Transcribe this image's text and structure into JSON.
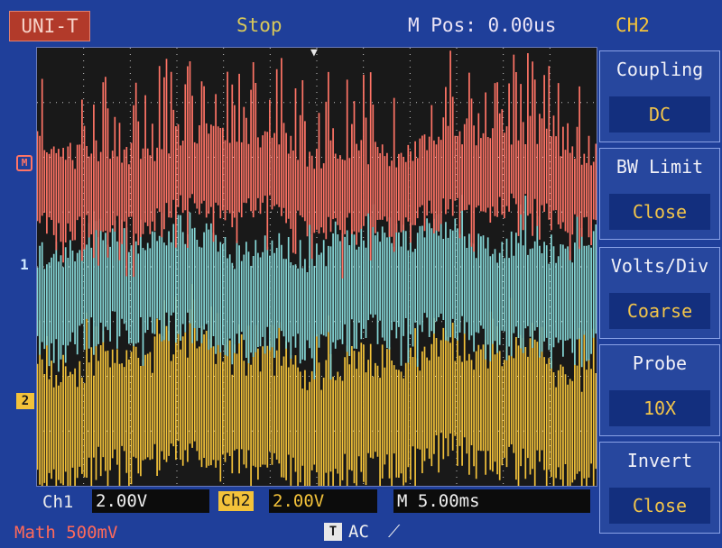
{
  "header": {
    "brand": "UNI-T",
    "run_status": "Stop",
    "m_pos": "M Pos: 0.00us",
    "channel": "CH2"
  },
  "plot": {
    "markers": {
      "math": "M",
      "ch1": "1",
      "ch2": "2"
    },
    "trigger_mark": "▼"
  },
  "menu": [
    {
      "title": "Coupling",
      "value": "DC"
    },
    {
      "title": "BW  Limit",
      "value": "Close"
    },
    {
      "title": "Volts/Div",
      "value": "Coarse"
    },
    {
      "title": "Probe",
      "value": "10X"
    },
    {
      "title": "Invert",
      "value": "Close"
    }
  ],
  "footer": {
    "ch1_label": "Ch1",
    "ch1_scale": "2.00V",
    "ch2_label": "Ch2",
    "ch2_scale": "2.00V",
    "timebase": "M 5.00ms",
    "math": "Math  500mV",
    "trigger_icon": "T",
    "trigger_coupling": "AC",
    "trigger_edge": "⟋"
  },
  "colors": {
    "math_trace": "#ff7466",
    "ch1_trace": "#86d8d8",
    "ch2_trace": "#f3c23a",
    "screen_bg": "#1f3f9a",
    "grid": "#c8c8c8"
  }
}
